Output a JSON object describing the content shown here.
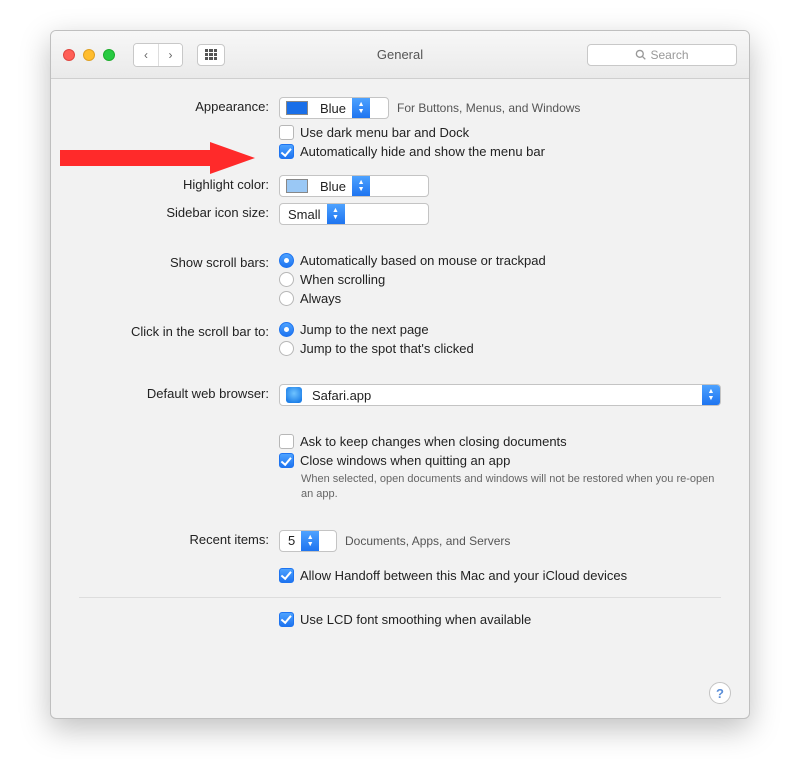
{
  "window": {
    "title": "General",
    "search_placeholder": "Search"
  },
  "appearance": {
    "label": "Appearance:",
    "value": "Blue",
    "hint": "For Buttons, Menus, and Windows",
    "dark_menu": {
      "checked": false,
      "label": "Use dark menu bar and Dock"
    },
    "auto_hide_menu": {
      "checked": true,
      "label": "Automatically hide and show the menu bar"
    }
  },
  "highlight": {
    "label": "Highlight color:",
    "value": "Blue"
  },
  "sidebar": {
    "label": "Sidebar icon size:",
    "value": "Small"
  },
  "scrollbars": {
    "label": "Show scroll bars:",
    "options": [
      {
        "label": "Automatically based on mouse or trackpad",
        "selected": true
      },
      {
        "label": "When scrolling",
        "selected": false
      },
      {
        "label": "Always",
        "selected": false
      }
    ]
  },
  "scrollclick": {
    "label": "Click in the scroll bar to:",
    "options": [
      {
        "label": "Jump to the next page",
        "selected": true
      },
      {
        "label": "Jump to the spot that's clicked",
        "selected": false
      }
    ]
  },
  "browser": {
    "label": "Default web browser:",
    "value": "Safari.app"
  },
  "documents": {
    "ask_keep": {
      "checked": false,
      "label": "Ask to keep changes when closing documents"
    },
    "close_windows": {
      "checked": true,
      "label": "Close windows when quitting an app"
    },
    "close_windows_hint": "When selected, open documents and windows will not be restored when you re-open an app."
  },
  "recent": {
    "label": "Recent items:",
    "value": "5",
    "hint": "Documents, Apps, and Servers"
  },
  "handoff": {
    "checked": true,
    "label": "Allow Handoff between this Mac and your iCloud devices"
  },
  "lcd": {
    "checked": true,
    "label": "Use LCD font smoothing when available"
  }
}
